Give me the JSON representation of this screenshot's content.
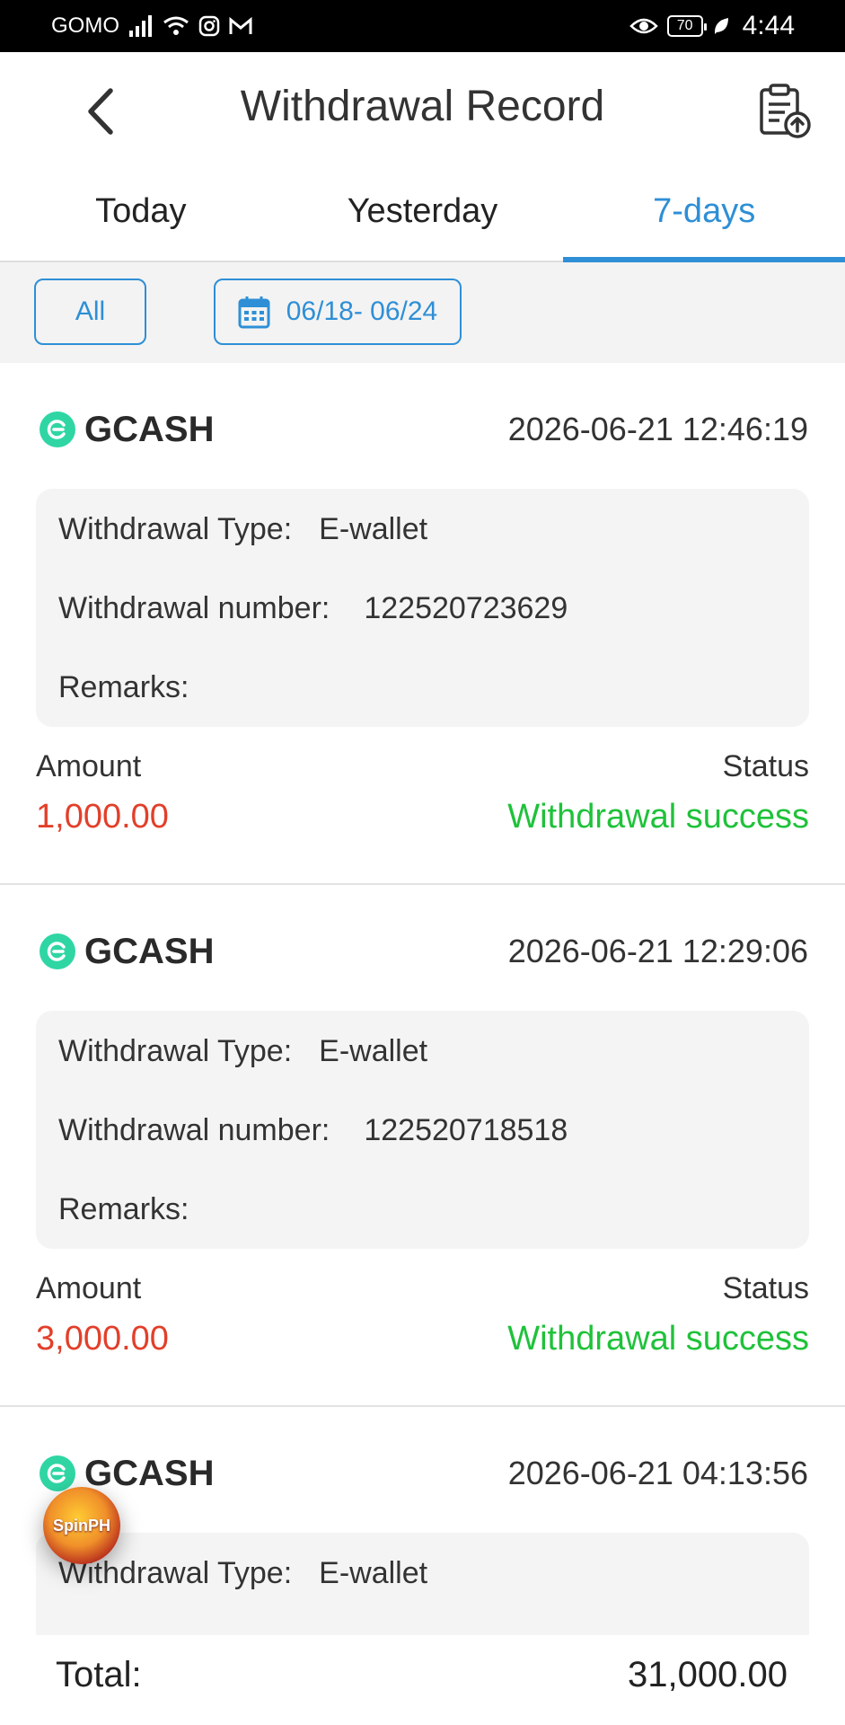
{
  "statusbar": {
    "carrier": "GOMO",
    "battery": "70",
    "time": "4:44"
  },
  "header": {
    "title": "Withdrawal Record"
  },
  "tabs": [
    {
      "label": "Today",
      "active": false
    },
    {
      "label": "Yesterday",
      "active": false
    },
    {
      "label": "7-days",
      "active": true
    }
  ],
  "filters": {
    "type_label": "All",
    "date_range": "06/18- 06/24"
  },
  "records": [
    {
      "provider": "GCASH",
      "datetime": "2026-06-21 12:46:19",
      "type_label": "Withdrawal Type:",
      "type_value": "E-wallet",
      "number_label": "Withdrawal number:",
      "number_value": "122520723629",
      "remarks_label": "Remarks:",
      "remarks_value": "",
      "amount_label": "Amount",
      "amount_value": "1,000.00",
      "status_label": "Status",
      "status_value": "Withdrawal success"
    },
    {
      "provider": "GCASH",
      "datetime": "2026-06-21 12:29:06",
      "type_label": "Withdrawal Type:",
      "type_value": "E-wallet",
      "number_label": "Withdrawal number:",
      "number_value": "122520718518",
      "remarks_label": "Remarks:",
      "remarks_value": "",
      "amount_label": "Amount",
      "amount_value": "3,000.00",
      "status_label": "Status",
      "status_value": "Withdrawal success"
    },
    {
      "provider": "GCASH",
      "datetime": "2026-06-21 04:13:56",
      "type_label": "Withdrawal Type:",
      "type_value": "E-wallet"
    }
  ],
  "floating_badge": {
    "label": "SpinPH"
  },
  "footer": {
    "total_label": "Total:",
    "total_value": "31,000.00"
  },
  "colors": {
    "accent": "#2e8fd6",
    "amount": "#e23f2a",
    "success": "#1fc23a",
    "gcash": "#2fd6a4"
  }
}
